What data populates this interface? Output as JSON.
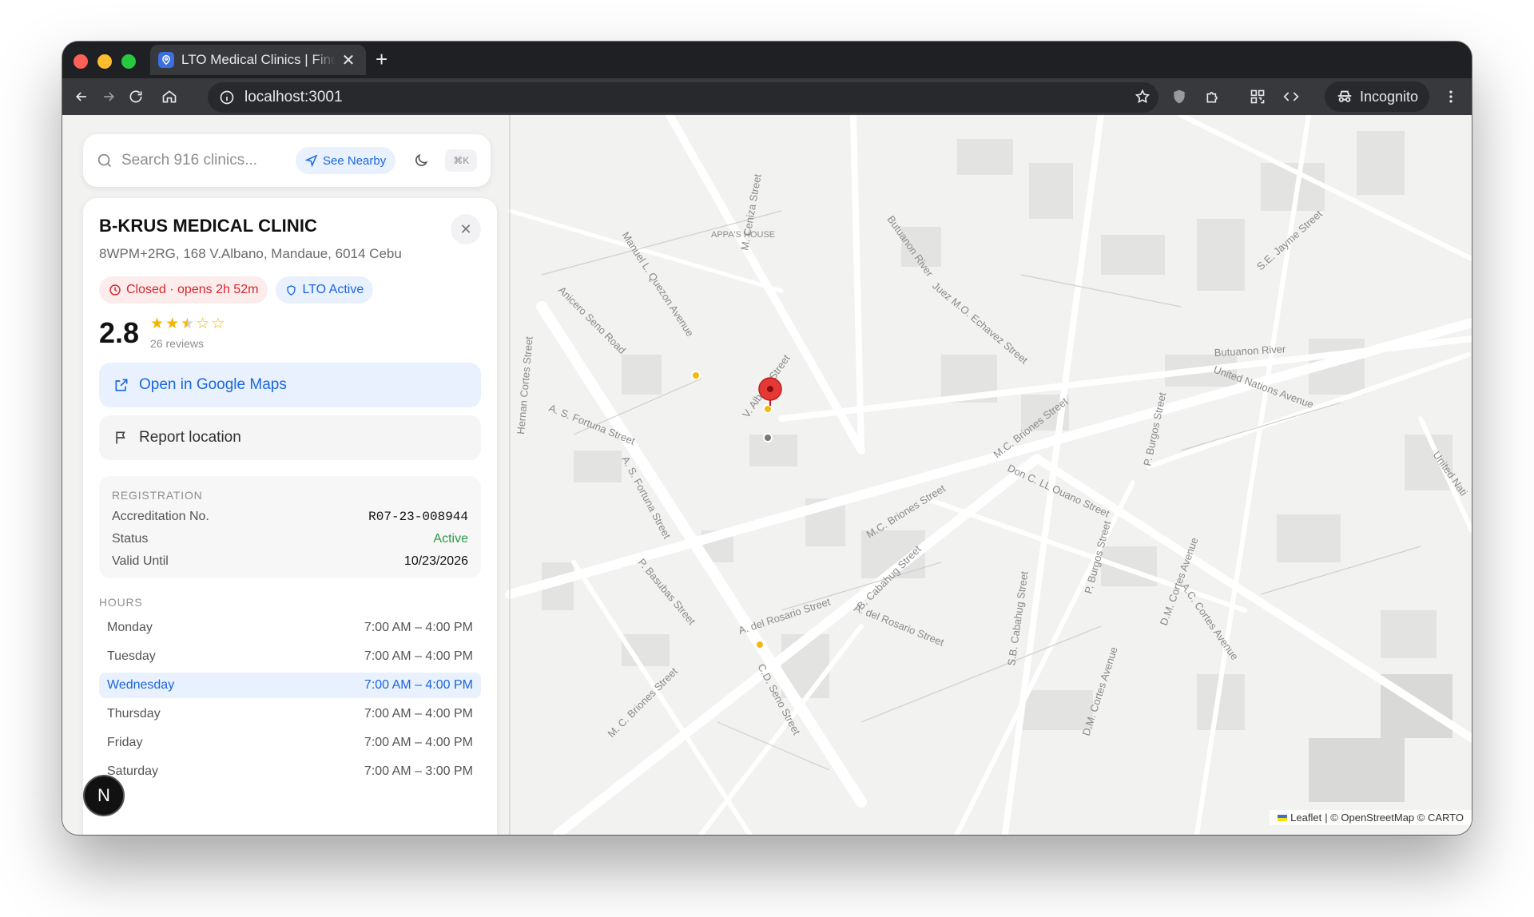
{
  "browser": {
    "tab_title": "LTO Medical Clinics | Find",
    "url": "localhost:3001",
    "mode_label": "Incognito"
  },
  "search": {
    "placeholder": "Search 916 clinics...",
    "nearby_label": "See Nearby",
    "shortcut": "⌘K"
  },
  "clinic": {
    "name": "B-KRUS MEDICAL CLINIC",
    "address": "8WPM+2RG, 168 V.Albano, Mandaue, 6014 Cebu",
    "status_badge": "Closed · opens 2h 52m",
    "lto_badge": "LTO Active",
    "rating": "2.8",
    "rating_value": 2.8,
    "reviews": "26 reviews",
    "open_maps_label": "Open in Google Maps",
    "report_label": "Report location"
  },
  "registration": {
    "heading": "REGISTRATION",
    "rows": [
      {
        "label": "Accreditation No.",
        "value": "R07-23-008944"
      },
      {
        "label": "Status",
        "value": "Active"
      },
      {
        "label": "Valid Until",
        "value": "10/23/2026"
      }
    ]
  },
  "hours": {
    "heading": "HOURS",
    "rows": [
      {
        "day": "Monday",
        "time": "7:00 AM – 4:00 PM"
      },
      {
        "day": "Tuesday",
        "time": "7:00 AM – 4:00 PM"
      },
      {
        "day": "Wednesday",
        "time": "7:00 AM – 4:00 PM"
      },
      {
        "day": "Thursday",
        "time": "7:00 AM – 4:00 PM"
      },
      {
        "day": "Friday",
        "time": "7:00 AM – 4:00 PM"
      },
      {
        "day": "Saturday",
        "time": "7:00 AM – 3:00 PM"
      }
    ]
  },
  "avatar_letter": "N",
  "map": {
    "attribution_leaflet": "Leaflet",
    "attribution_rest": "| © OpenStreetMap © CARTO",
    "streets": {
      "s1": "A. S. Fortuna Street",
      "s2": "A. S. Fortuna Street",
      "s3": "Manuel L. Quezon Avenue",
      "s4": "Anicero Seno Road",
      "s5": "Hernan Cortes Street",
      "s6": "M. Ceniza Street",
      "s7": "V. Albano Street",
      "s8": "Butuanon River",
      "s9": "Butuanon River",
      "s10": "United Nations Avenue",
      "s11": "Juez M.O. Echavez Street",
      "s12": "M.C. Briones Street",
      "s13": "M.C. Briones Street",
      "s14": "Don C. LL Ouano Street",
      "s15": "P. Burgos Street",
      "s16": "D.M. Cortes Avenue",
      "s17": "S.E. Jayme Street",
      "s18": "B. Cabahug Street",
      "s19": "P. Basubas Street",
      "s20": "A. del Rosario Street",
      "s21": "A. del Rosario Street",
      "s22": "C.D. Seno Street",
      "s23": "M. C. Briones Street",
      "s24": "S.B. Cabahug Street",
      "s25": "P. Burgos Street",
      "s26": "A.C. Cortes Avenue",
      "s27": "D.M. Cortes Avenue",
      "s28": "APPA'S HOUSE",
      "s29": "United Nati"
    }
  }
}
